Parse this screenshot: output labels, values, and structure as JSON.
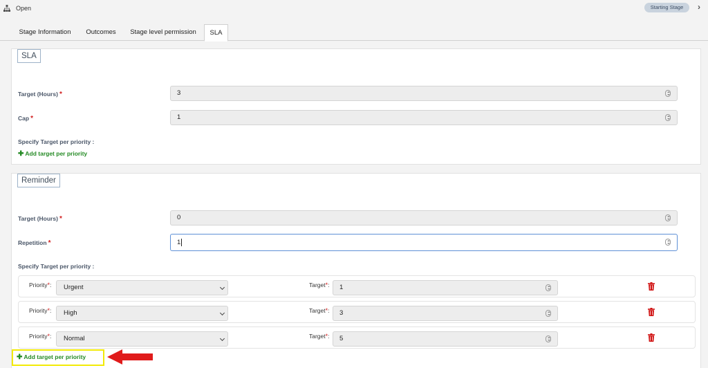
{
  "header": {
    "stage_icon": "sitemap-icon",
    "stage_name": "Open",
    "badge": "Starting Stage",
    "next_icon": "chevron-right-icon"
  },
  "tabs": [
    {
      "label": "Stage Information",
      "active": false
    },
    {
      "label": "Outcomes",
      "active": false
    },
    {
      "label": "Stage level permission",
      "active": false
    },
    {
      "label": "SLA",
      "active": true
    }
  ],
  "sla": {
    "legend": "SLA",
    "target_label": "Target (Hours)",
    "target_value": "3",
    "cap_label": "Cap",
    "cap_value": "1",
    "specify_label": "Specify Target per priority :",
    "add_label": "Add target per priority"
  },
  "reminder": {
    "legend": "Reminder",
    "target_label": "Target (Hours)",
    "target_value": "0",
    "repetition_label": "Repetition",
    "repetition_value": "1",
    "specify_label": "Specify Target per priority :",
    "priority_label": "Priority",
    "target_row_label": "Target",
    "rows": [
      {
        "priority": "Urgent",
        "target": "1"
      },
      {
        "priority": "High",
        "target": "3"
      },
      {
        "priority": "Normal",
        "target": "5"
      }
    ],
    "add_label": "Add target per priority"
  },
  "colors": {
    "required": "#d12020",
    "add_link": "#248a24",
    "delete_icon": "#d01010",
    "highlight": "#f2ea05",
    "arrow": "#e01b1b"
  },
  "icons": {
    "delete": "trash-icon",
    "spinner": "spinner-icon",
    "select": "chevron-down-icon",
    "add": "plus-icon",
    "annotation": "arrow-left-icon"
  }
}
